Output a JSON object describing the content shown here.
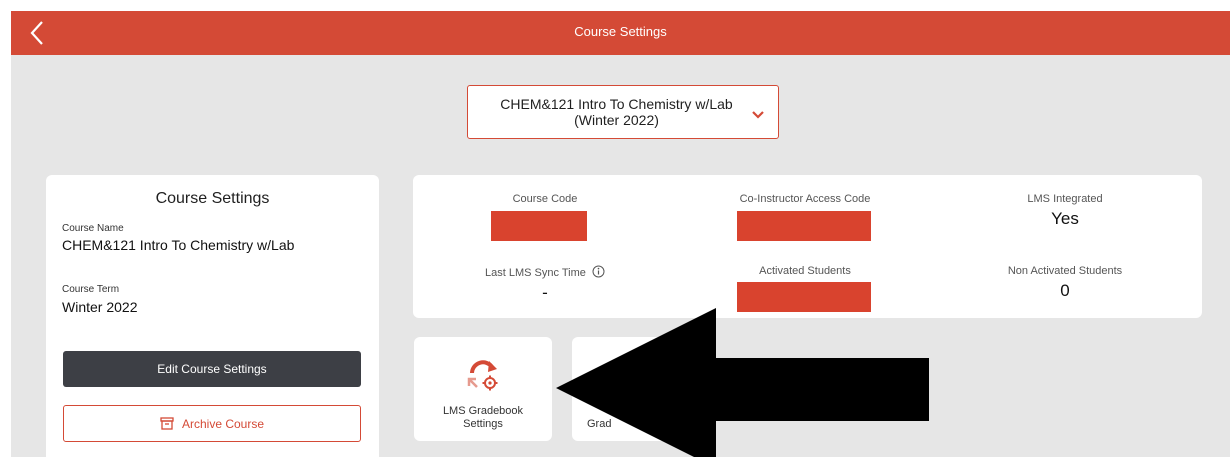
{
  "header": {
    "title": "Course Settings"
  },
  "course_selector": {
    "line1": "CHEM&121 Intro To Chemistry w/Lab",
    "line2": "(Winter 2022)"
  },
  "settings_card": {
    "title": "Course Settings",
    "course_name_label": "Course Name",
    "course_name": "CHEM&121 Intro To Chemistry w/Lab",
    "course_term_label": "Course Term",
    "course_term": "Winter 2022",
    "edit_label": "Edit Course Settings",
    "archive_label": "Archive Course"
  },
  "info": {
    "course_code_label": "Course Code",
    "coinstructor_label": "Co-Instructor Access Code",
    "lms_integrated_label": "LMS Integrated",
    "lms_integrated_value": "Yes",
    "last_sync_label": "Last LMS Sync Time",
    "last_sync_value": "-",
    "activated_label": "Activated Students",
    "non_activated_label": "Non Activated Students",
    "non_activated_value": "0"
  },
  "tiles": {
    "lms_gradebook_line1": "LMS Gradebook",
    "lms_gradebook_line2": "Settings",
    "second_tile_partial": "Grad"
  },
  "colors": {
    "accent": "#d44a36",
    "background": "#e6e6e6",
    "dark_button": "#3d3f45"
  }
}
